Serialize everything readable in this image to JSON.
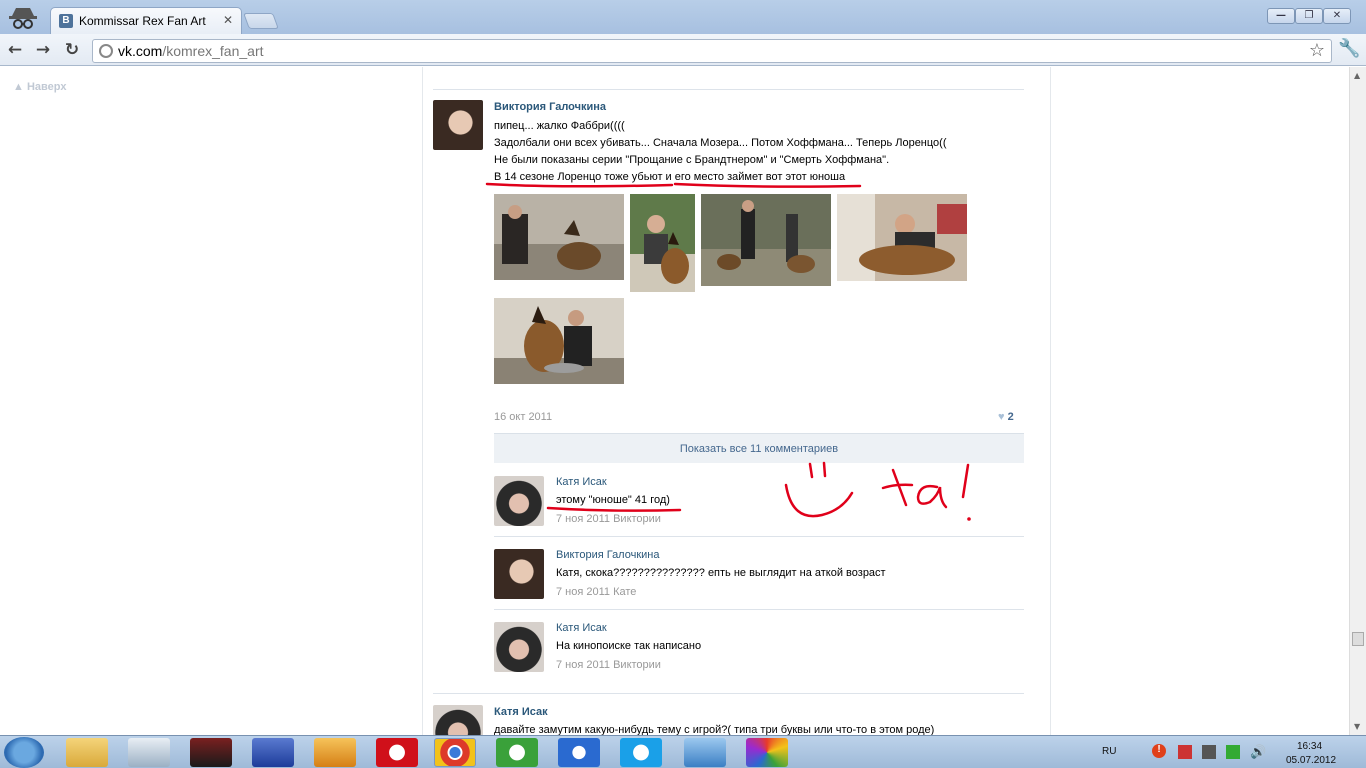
{
  "browser": {
    "tab_title": "Kommissar Rex Fan Art",
    "tab_favicon_letter": "В",
    "url_host": "vk.com",
    "url_path": "/komrex_fan_art"
  },
  "page": {
    "back_to_top": "Наверх"
  },
  "post1": {
    "author": "Виктория Галочкина",
    "lines": [
      "пипец... жалко Фаббри((((",
      "Задолбали они всех убивать... Сначала Мозера... Потом Хоффмана... Теперь Лоренцо((",
      "Не были показаны серии \"Прощание с Брандтнером\" и \"Смерть Хоффмана\".",
      "В 14 сезоне Лоренцо тоже убьют и его место займет вот этот юноша"
    ],
    "date": "16 окт 2011",
    "likes": "2",
    "show_all_comments": "Показать все 11 комментариев"
  },
  "comments": [
    {
      "author": "Катя Исак",
      "text": "этому \"юноше\" 41 год)",
      "meta": "7 ноя 2011 Виктории"
    },
    {
      "author": "Виктория Галочкина",
      "text": "Катя, скока??????????????? епть не выглядит на аткой возраст",
      "meta": "7 ноя 2011 Кате"
    },
    {
      "author": "Катя Исак",
      "text": "На кинопоиске так написано",
      "meta": "7 ноя 2011 Виктории"
    }
  ],
  "post2": {
    "author": "Катя Исак",
    "line": "давайте замутим какую-нибудь тему с игрой?( типа три буквы или что-то в этом роде)"
  },
  "taskbar": {
    "lang": "RU",
    "time": "16:34",
    "date": "05.07.2012"
  }
}
